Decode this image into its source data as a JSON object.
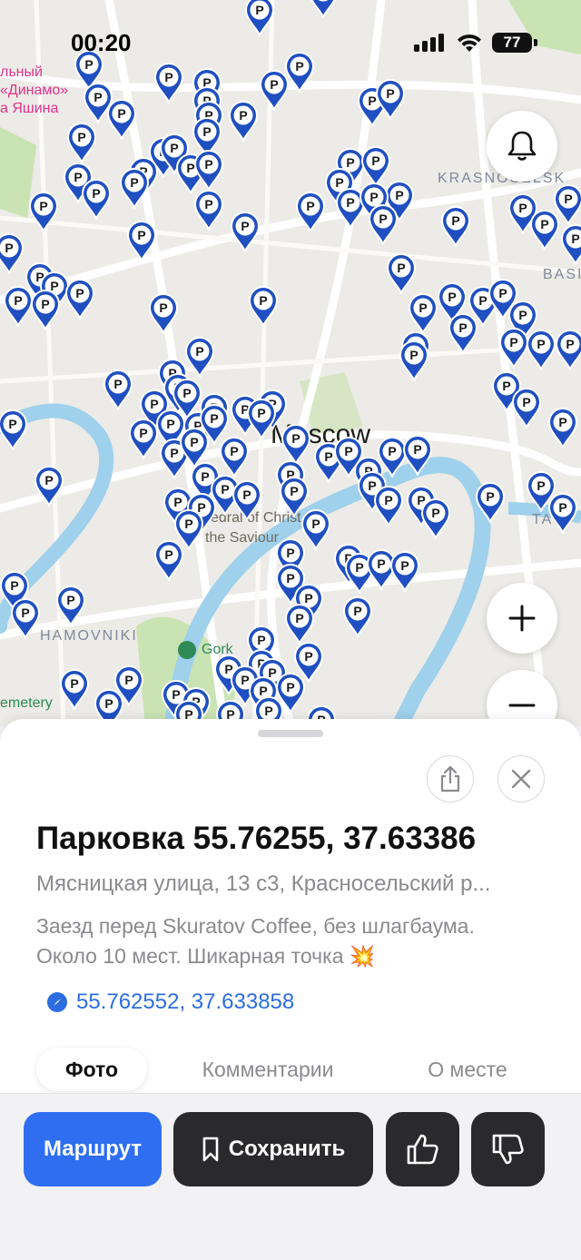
{
  "status_bar": {
    "time": "00:20",
    "battery": "77"
  },
  "map": {
    "city_label": "Moscow",
    "district_labels": [
      "KRASNOSELSK",
      "BASI",
      "HAMOVNIKI",
      "TA"
    ],
    "poi_labels": [
      "edral of Christ",
      "the Saviour",
      "Gork",
      "emetery"
    ],
    "pink_labels": [
      "льный",
      "«Динамо»",
      "а Яшина"
    ],
    "pin_letter": "P",
    "pin_color": "#1f4fc1",
    "water_color": "#9fd0ec",
    "park_color": "#c9e3b3"
  },
  "sheet": {
    "title": "Парковка 55.76255, 37.63386",
    "address": "Мясницкая улица, 13 с3, Красносельский р...",
    "description_line1": "Заезд перед Skuratov Coffee, без шлагбаума.",
    "description_line2": "Около 10 мест. Шикарная точка 💥",
    "coordinates": "55.762552, 37.633858",
    "tabs": [
      {
        "label": "Фото",
        "active": true
      },
      {
        "label": "Комментарии",
        "active": false
      },
      {
        "label": "О месте",
        "active": false
      }
    ]
  },
  "actions": {
    "route_label": "Маршрут",
    "save_label": "Сохранить",
    "accent_color": "#2f6ef0"
  }
}
